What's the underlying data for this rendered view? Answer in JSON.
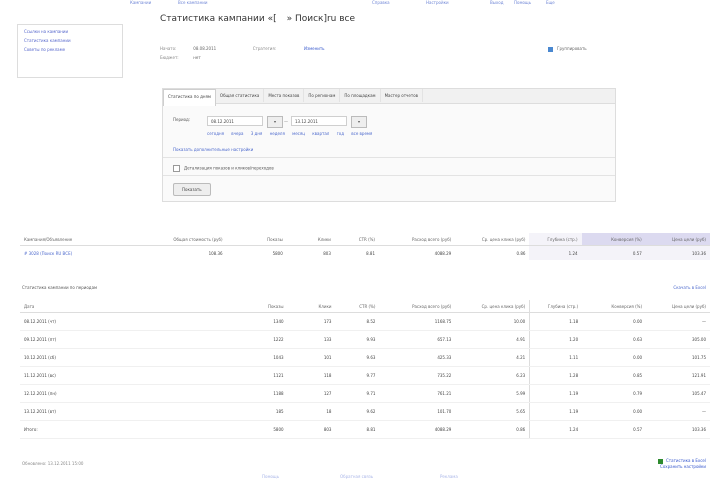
{
  "topnav": [
    "Кампании",
    "Все кампании",
    "Справка",
    "Настройки",
    "Выход",
    "Помощь",
    "Еще"
  ],
  "sidebar": {
    "items": [
      "Ссылки на кампании",
      "Статистика кампании",
      "Советы по рекламе"
    ]
  },
  "header": {
    "title": "Статистика кампании «[",
    "period": "» Поиск]ru все",
    "region": ""
  },
  "meta": {
    "created_label": "Начато:",
    "created_value": "08.08.2011",
    "status_label": "Стратегия:",
    "status_link": "Изменить",
    "budget_label": "Бюджет:",
    "budget_value": "нет"
  },
  "legend_label": "Группировать",
  "panel": {
    "tabs": [
      "Статистика по дням",
      "Общая статистика",
      "Места показов",
      "По регионам",
      "По площадкам",
      "Мастер отчетов"
    ],
    "period_label": "Период:",
    "date_from": "08.12.2011",
    "date_to": "13.12.2011",
    "date_sep": "—",
    "cal_label": "▾",
    "presets": [
      "сегодня",
      "вчера",
      "3 дня",
      "неделя",
      "месяц",
      "квартал",
      "год",
      "все время"
    ],
    "extra_link": "Показать дополнительные настройки",
    "option_label": "Детализация показов и кликов/переходов",
    "show_button": "Показать"
  },
  "summary": {
    "headers": [
      "Кампания/Объявление",
      "Общая стоимость (руб)",
      "Показы",
      "Клики",
      "CTR (%)",
      "Расход всего (руб)",
      "Ср. цена клика (руб)",
      "Глубина (стр.)",
      "Конверсия (%)",
      "Цена цели (руб)"
    ],
    "row": [
      "# 3028 (Поиск RU ВСЕ)",
      "108.36",
      "5800",
      "803",
      "8.81",
      "4088.29",
      "0.86",
      "1.24",
      "0.57",
      "103.36"
    ]
  },
  "stats": {
    "heading": "Статистика кампании по периодам",
    "link": "Скачать в Excel",
    "headers": [
      "Дата",
      "Показы",
      "Клики",
      "CTR (%)",
      "Расход всего (руб)",
      "Ср. цена клика (руб)",
      "Глубина (стр.)",
      "Конверсия (%)",
      "Цена цели (руб)"
    ],
    "rows": [
      [
        "08.12.2011 (чт)",
        "1340",
        "173",
        "8.52",
        "1168.75",
        "10.00",
        "1.18",
        "0.00",
        "—"
      ],
      [
        "09.12.2011 (пт)",
        "1222",
        "133",
        "9.93",
        "657.13",
        "4.91",
        "1.20",
        "0.63",
        "305.00"
      ],
      [
        "10.12.2011 (сб)",
        "1043",
        "101",
        "9.63",
        "425.33",
        "4.21",
        "1.11",
        "0.00",
        "101.75"
      ],
      [
        "11.12.2011 (вс)",
        "1121",
        "118",
        "9.77",
        "735.22",
        "6.23",
        "1.28",
        "0.85",
        "121.91"
      ],
      [
        "12.12.2011 (пн)",
        "1188",
        "127",
        "9.71",
        "761.21",
        "5.99",
        "1.19",
        "0.79",
        "105.47"
      ],
      [
        "13.12.2011 (вт)",
        "185",
        "18",
        "9.62",
        "101.70",
        "5.65",
        "1.19",
        "0.00",
        "—"
      ],
      [
        "Итого:",
        "5800",
        "803",
        "8.81",
        "4088.29",
        "0.86",
        "1.24",
        "0.57",
        "103.36"
      ]
    ]
  },
  "footer": {
    "left": "Обновлено: 13.12.2011 15:00",
    "right_top": "Статистика в Excel",
    "right_bottom": "Сохранить настройки"
  },
  "bottombar": [
    "Помощь",
    "Обратная связь",
    "Реклама"
  ]
}
